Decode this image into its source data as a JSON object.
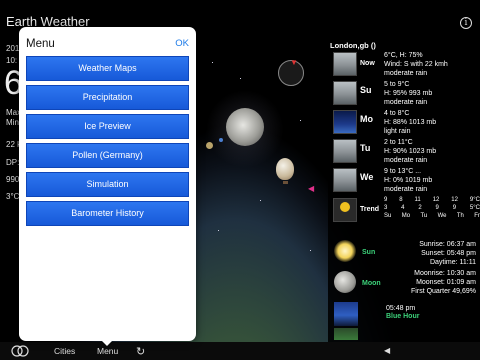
{
  "app": {
    "title": "Earth Weather"
  },
  "left_overlay": {
    "temp_big": "6",
    "line_year": "201",
    "line_time": "10:",
    "line_max": "Max",
    "line_min": "Min",
    "line_wind": "22 k",
    "line_dp": "DP:",
    "line_pressure": "990",
    "line_temp": "3°C"
  },
  "menu": {
    "title": "Menu",
    "ok": "OK",
    "items": [
      "Weather Maps",
      "Precipitation",
      "Ice Preview",
      "Pollen (Germany)",
      "Simulation",
      "Barometer History"
    ]
  },
  "forecast": {
    "location": "London,gb ()",
    "rows": [
      {
        "day": "Now",
        "lines": [
          "6°C, H: 75%",
          "Wind: S with 22 kmh",
          "moderate rain"
        ]
      },
      {
        "day": "Su",
        "lines": [
          "5 to 9°C",
          "H: 95% 993 mb",
          "moderate rain"
        ]
      },
      {
        "day": "Mo",
        "lines": [
          "4 to 8°C",
          "H: 88% 1013 mb",
          "light rain"
        ]
      },
      {
        "day": "Tu",
        "lines": [
          "2 to 11°C",
          "H: 90% 1023 mb",
          "moderate rain"
        ]
      },
      {
        "day": "We",
        "lines": [
          "9 to 13°C ...",
          "H: 0% 1019 mb",
          "moderate rain"
        ]
      }
    ],
    "trend": {
      "label": "Trend",
      "row1": [
        "9",
        "8",
        "11",
        "12",
        "12",
        "9°C"
      ],
      "row2": [
        "3",
        "4",
        "2",
        "9",
        "9",
        "5°C"
      ],
      "row3": [
        "Su",
        "Mo",
        "Tu",
        "We",
        "Th",
        "Fr"
      ]
    }
  },
  "astro": {
    "sun": {
      "label": "Sun",
      "lines": [
        "Sunrise: 06:37 am",
        "Sunset: 05:48 pm",
        "Daytime: 11:11"
      ]
    },
    "moon": {
      "label": "Moon",
      "lines": [
        "Moonrise: 10:30 am",
        "Moonset: 01:09 am",
        "First Quarter 49,69%"
      ]
    },
    "blue_hour": {
      "label": "Blue Hour",
      "time": "05:48 pm"
    }
  },
  "bottombar": {
    "tab_cities": "Cities",
    "tab_menu": "Menu"
  },
  "icons": [
    "info-icon",
    "menu-icon",
    "refresh-icon",
    "back-arrow-icon",
    "compass-icon"
  ],
  "colors": {
    "menu_button": "#1e62e0",
    "accent_ok": "#1d7be8",
    "astro_label": "#3cd27a"
  }
}
